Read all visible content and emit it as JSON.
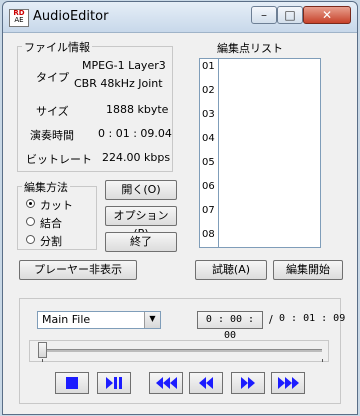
{
  "window": {
    "title": "AudioEditor",
    "icon_text_top": "RD",
    "icon_text_bottom": "AE"
  },
  "file_info": {
    "group_label": "ファイル情報",
    "type_label": "タイプ",
    "type_value_1": "MPEG-1 Layer3",
    "type_value_2": "CBR 48kHz Joint",
    "size_label": "サイズ",
    "size_value": "1888 kbyte",
    "duration_label": "演奏時間",
    "duration_value": "0 : 01 : 09.04",
    "bitrate_label": "ビットレート",
    "bitrate_value": "224.00 kbps"
  },
  "edit_points": {
    "label": "編集点リスト",
    "numbers": [
      "01",
      "02",
      "03",
      "04",
      "05",
      "06",
      "07",
      "08"
    ]
  },
  "edit_method": {
    "group_label": "編集方法",
    "options": [
      "カット",
      "結合",
      "分割"
    ],
    "selected": "カット"
  },
  "buttons": {
    "open": "開く(O)",
    "options": "オプション(P)",
    "exit": "終了",
    "hide_player": "プレーヤー非表示",
    "preview": "試聴(A)",
    "start_edit": "編集開始"
  },
  "player": {
    "file_select": "Main File",
    "current_time": "0 : 00 : 00",
    "separator": "/",
    "total_time": "0 : 01 : 09",
    "position": 0
  }
}
